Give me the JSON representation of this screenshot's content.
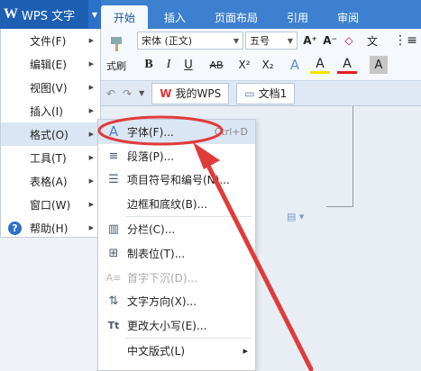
{
  "app": {
    "logo": "W",
    "title": "WPS 文字",
    "dropdown": "▼"
  },
  "tabs": [
    {
      "label": "开始"
    },
    {
      "label": "插入"
    },
    {
      "label": "页面布局"
    },
    {
      "label": "引用"
    },
    {
      "label": "审阅"
    }
  ],
  "ribbon": {
    "paste_label": "式刷",
    "font_name": "宋体 (正文)",
    "font_size": "五号",
    "grow": "A⁺",
    "shrink": "A⁻",
    "clear": "◇",
    "phonetic": "文",
    "bold": "B",
    "italic": "I",
    "underline": "U",
    "strike": "AB",
    "superscript": "X²",
    "subscript": "X₂",
    "text_effect": "A",
    "highlight": "A",
    "font_color": "A",
    "char_shade": "A"
  },
  "quick_access": {
    "undo": "↶",
    "redo": "↷",
    "more": "▼",
    "home_tab": "我的WPS",
    "doc_tab": "文档1"
  },
  "main_menu": [
    {
      "label": "文件(F)"
    },
    {
      "label": "编辑(E)"
    },
    {
      "label": "视图(V)"
    },
    {
      "label": "插入(I)"
    },
    {
      "label": "格式(O)"
    },
    {
      "label": "工具(T)"
    },
    {
      "label": "表格(A)"
    },
    {
      "label": "窗口(W)"
    },
    {
      "label": "帮助(H)"
    }
  ],
  "submenu": [
    {
      "label": "字体(F)...",
      "shortcut": "Ctrl+D",
      "icon": "A"
    },
    {
      "label": "段落(P)...",
      "shortcut": "",
      "icon": "≡"
    },
    {
      "label": "项目符号和编号(N)...",
      "shortcut": "",
      "icon": "☰"
    },
    {
      "label": "边框和底纹(B)...",
      "shortcut": "",
      "icon": ""
    },
    {
      "label": "分栏(C)...",
      "shortcut": "",
      "icon": "▥"
    },
    {
      "label": "制表位(T)...",
      "shortcut": "",
      "icon": "⊞"
    },
    {
      "label": "首字下沉(D)...",
      "shortcut": "",
      "icon": "A≡"
    },
    {
      "label": "文字方向(X)...",
      "shortcut": "",
      "icon": "⇅"
    },
    {
      "label": "更改大小写(E)...",
      "shortcut": "",
      "icon": "Tt"
    },
    {
      "label": "中文版式(L)",
      "shortcut": "",
      "icon": ""
    }
  ],
  "colors": {
    "accent": "#3d80cf",
    "highlight_annotation": "#e03b3b"
  }
}
